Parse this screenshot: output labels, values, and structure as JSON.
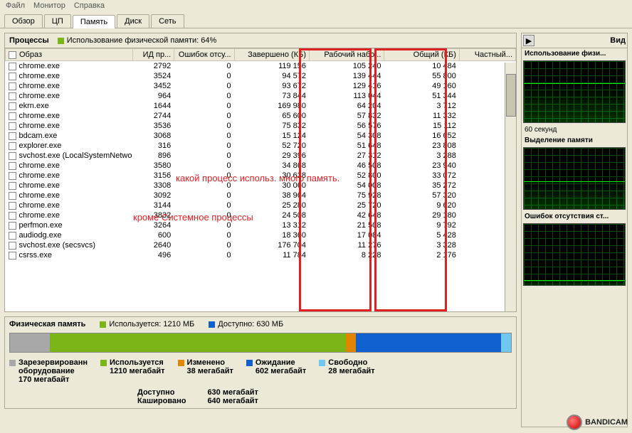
{
  "menu": {
    "file": "Файл",
    "monitor": "Монитор",
    "help": "Справка"
  },
  "tabs": {
    "overview": "Обзор",
    "cpu": "ЦП",
    "memory": "Память",
    "disk": "Диск",
    "network": "Сеть"
  },
  "processes": {
    "title": "Процессы",
    "usage_label": "Использование физической памяти: 64%",
    "columns": {
      "image": "Образ",
      "pid": "ИД пр...",
      "faults": "Ошибок отсу...",
      "commit": "Завершено (КБ)",
      "working": "Рабочий набо...",
      "shared": "Общий (КБ)",
      "private": "Частный..."
    },
    "rows": [
      {
        "img": "chrome.exe",
        "pid": "2792",
        "f": "0",
        "c": "119 156",
        "w": "105 240",
        "s": "10 484",
        "p": ""
      },
      {
        "img": "chrome.exe",
        "pid": "3524",
        "f": "0",
        "c": "94 572",
        "w": "139 444",
        "s": "55 800",
        "p": ""
      },
      {
        "img": "chrome.exe",
        "pid": "3452",
        "f": "0",
        "c": "93 672",
        "w": "129 416",
        "s": "49 160",
        "p": ""
      },
      {
        "img": "chrome.exe",
        "pid": "964",
        "f": "0",
        "c": "73 844",
        "w": "113 044",
        "s": "51 344",
        "p": ""
      },
      {
        "img": "ekrn.exe",
        "pid": "1644",
        "f": "0",
        "c": "169 980",
        "w": "64 204",
        "s": "3 712",
        "p": ""
      },
      {
        "img": "chrome.exe",
        "pid": "2744",
        "f": "0",
        "c": "65 600",
        "w": "57 832",
        "s": "11 332",
        "p": ""
      },
      {
        "img": "chrome.exe",
        "pid": "3536",
        "f": "0",
        "c": "75 832",
        "w": "56 576",
        "s": "15 112",
        "p": ""
      },
      {
        "img": "bdcam.exe",
        "pid": "3068",
        "f": "0",
        "c": "15 124",
        "w": "54 308",
        "s": "16 652",
        "p": ""
      },
      {
        "img": "explorer.exe",
        "pid": "316",
        "f": "0",
        "c": "52 720",
        "w": "51 648",
        "s": "23 808",
        "p": ""
      },
      {
        "img": "svchost.exe (LocalSystemNetwo...",
        "pid": "896",
        "f": "0",
        "c": "29 396",
        "w": "27 312",
        "s": "3 288",
        "p": ""
      },
      {
        "img": "chrome.exe",
        "pid": "3580",
        "f": "0",
        "c": "34 868",
        "w": "46 508",
        "s": "23 940",
        "p": ""
      },
      {
        "img": "chrome.exe",
        "pid": "3156",
        "f": "0",
        "c": "30 628",
        "w": "52 800",
        "s": "33 072",
        "p": ""
      },
      {
        "img": "chrome.exe",
        "pid": "3308",
        "f": "0",
        "c": "30 060",
        "w": "54 008",
        "s": "35 272",
        "p": ""
      },
      {
        "img": "chrome.exe",
        "pid": "3092",
        "f": "0",
        "c": "38 964",
        "w": "75 928",
        "s": "57 320",
        "p": ""
      },
      {
        "img": "chrome.exe",
        "pid": "3144",
        "f": "0",
        "c": "25 280",
        "w": "25 720",
        "s": "9 620",
        "p": ""
      },
      {
        "img": "chrome.exe",
        "pid": "3832",
        "f": "0",
        "c": "24 508",
        "w": "42 648",
        "s": "29 180",
        "p": ""
      },
      {
        "img": "perfmon.exe",
        "pid": "3264",
        "f": "0",
        "c": "13 312",
        "w": "21 508",
        "s": "9 792",
        "p": ""
      },
      {
        "img": "audiodg.exe",
        "pid": "600",
        "f": "0",
        "c": "18 360",
        "w": "17 084",
        "s": "5 428",
        "p": ""
      },
      {
        "img": "svchost.exe (secsvcs)",
        "pid": "2640",
        "f": "0",
        "c": "176 704",
        "w": "11 276",
        "s": "3 328",
        "p": ""
      },
      {
        "img": "csrss.exe",
        "pid": "496",
        "f": "0",
        "c": "11 784",
        "w": "8 228",
        "s": "2 176",
        "p": ""
      }
    ]
  },
  "annotations": {
    "text1": "какой процесс использ. много память.",
    "text2": "кроме Системное процессы"
  },
  "physmem": {
    "title": "Физическая память",
    "used_label": "Используется: 1210 МБ",
    "avail_label": "Доступно: 630 МБ",
    "legend": {
      "reserved": {
        "label": "Зарезервированн",
        "sub": "оборудование",
        "val": "170 мегабайт",
        "color": "#a8a8a8"
      },
      "used": {
        "label": "Используется",
        "val": "1210 мегабайт",
        "color": "#7cb518"
      },
      "modified": {
        "label": "Изменено",
        "val": "38 мегабайт",
        "color": "#e08600"
      },
      "standby": {
        "label": "Ожидание",
        "val": "602 мегабайт",
        "color": "#1060d0"
      },
      "free": {
        "label": "Свободно",
        "val": "28 мегабайт",
        "color": "#70c8f0"
      }
    },
    "footer": {
      "avail": "Доступно",
      "avail_v": "630 мегабайт",
      "cached": "Кашировано",
      "cached_v": "640 мегабайт"
    }
  },
  "right": {
    "views": "Вид",
    "g1": "Использование физи...",
    "g2": "60 секунд",
    "g3": "Выделение памяти",
    "g4": "Ошибок отсутствия ст..."
  },
  "watermark": "BANDICAM"
}
